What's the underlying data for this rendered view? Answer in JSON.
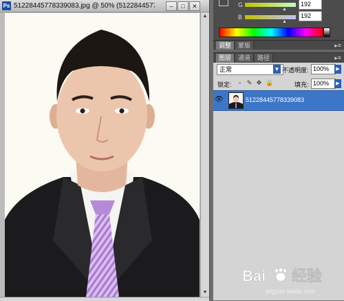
{
  "document": {
    "app_icon": "Ps",
    "title": "5122844577833908​3.jpg @ 50% (5122844577...",
    "buttons": {
      "minimize": "–",
      "restore": "□",
      "close": "✕"
    }
  },
  "color_panel": {
    "g_label": "G",
    "b_label": "B",
    "g_value": "192",
    "b_value": "192"
  },
  "adjust_tabs": [
    "调整",
    "蒙版"
  ],
  "layers_tabs": [
    "图层",
    "通道",
    "路径"
  ],
  "layers": {
    "blend_mode": "正常",
    "opacity_label": "不透明度:",
    "opacity_value": "100%",
    "lock_label": "锁定:",
    "fill_label": "填充:",
    "fill_value": "100%",
    "items": [
      {
        "name": "512284457783390​83",
        "visible": true,
        "selected": true
      }
    ]
  },
  "watermark": {
    "brand": "Bai",
    "brand_suffix": "经验",
    "url": "jingyan.baidu.com"
  },
  "colors": {
    "selection": "#3c76c8",
    "panel_dark": "#4c4c4c",
    "tie": "#b58ad6"
  }
}
